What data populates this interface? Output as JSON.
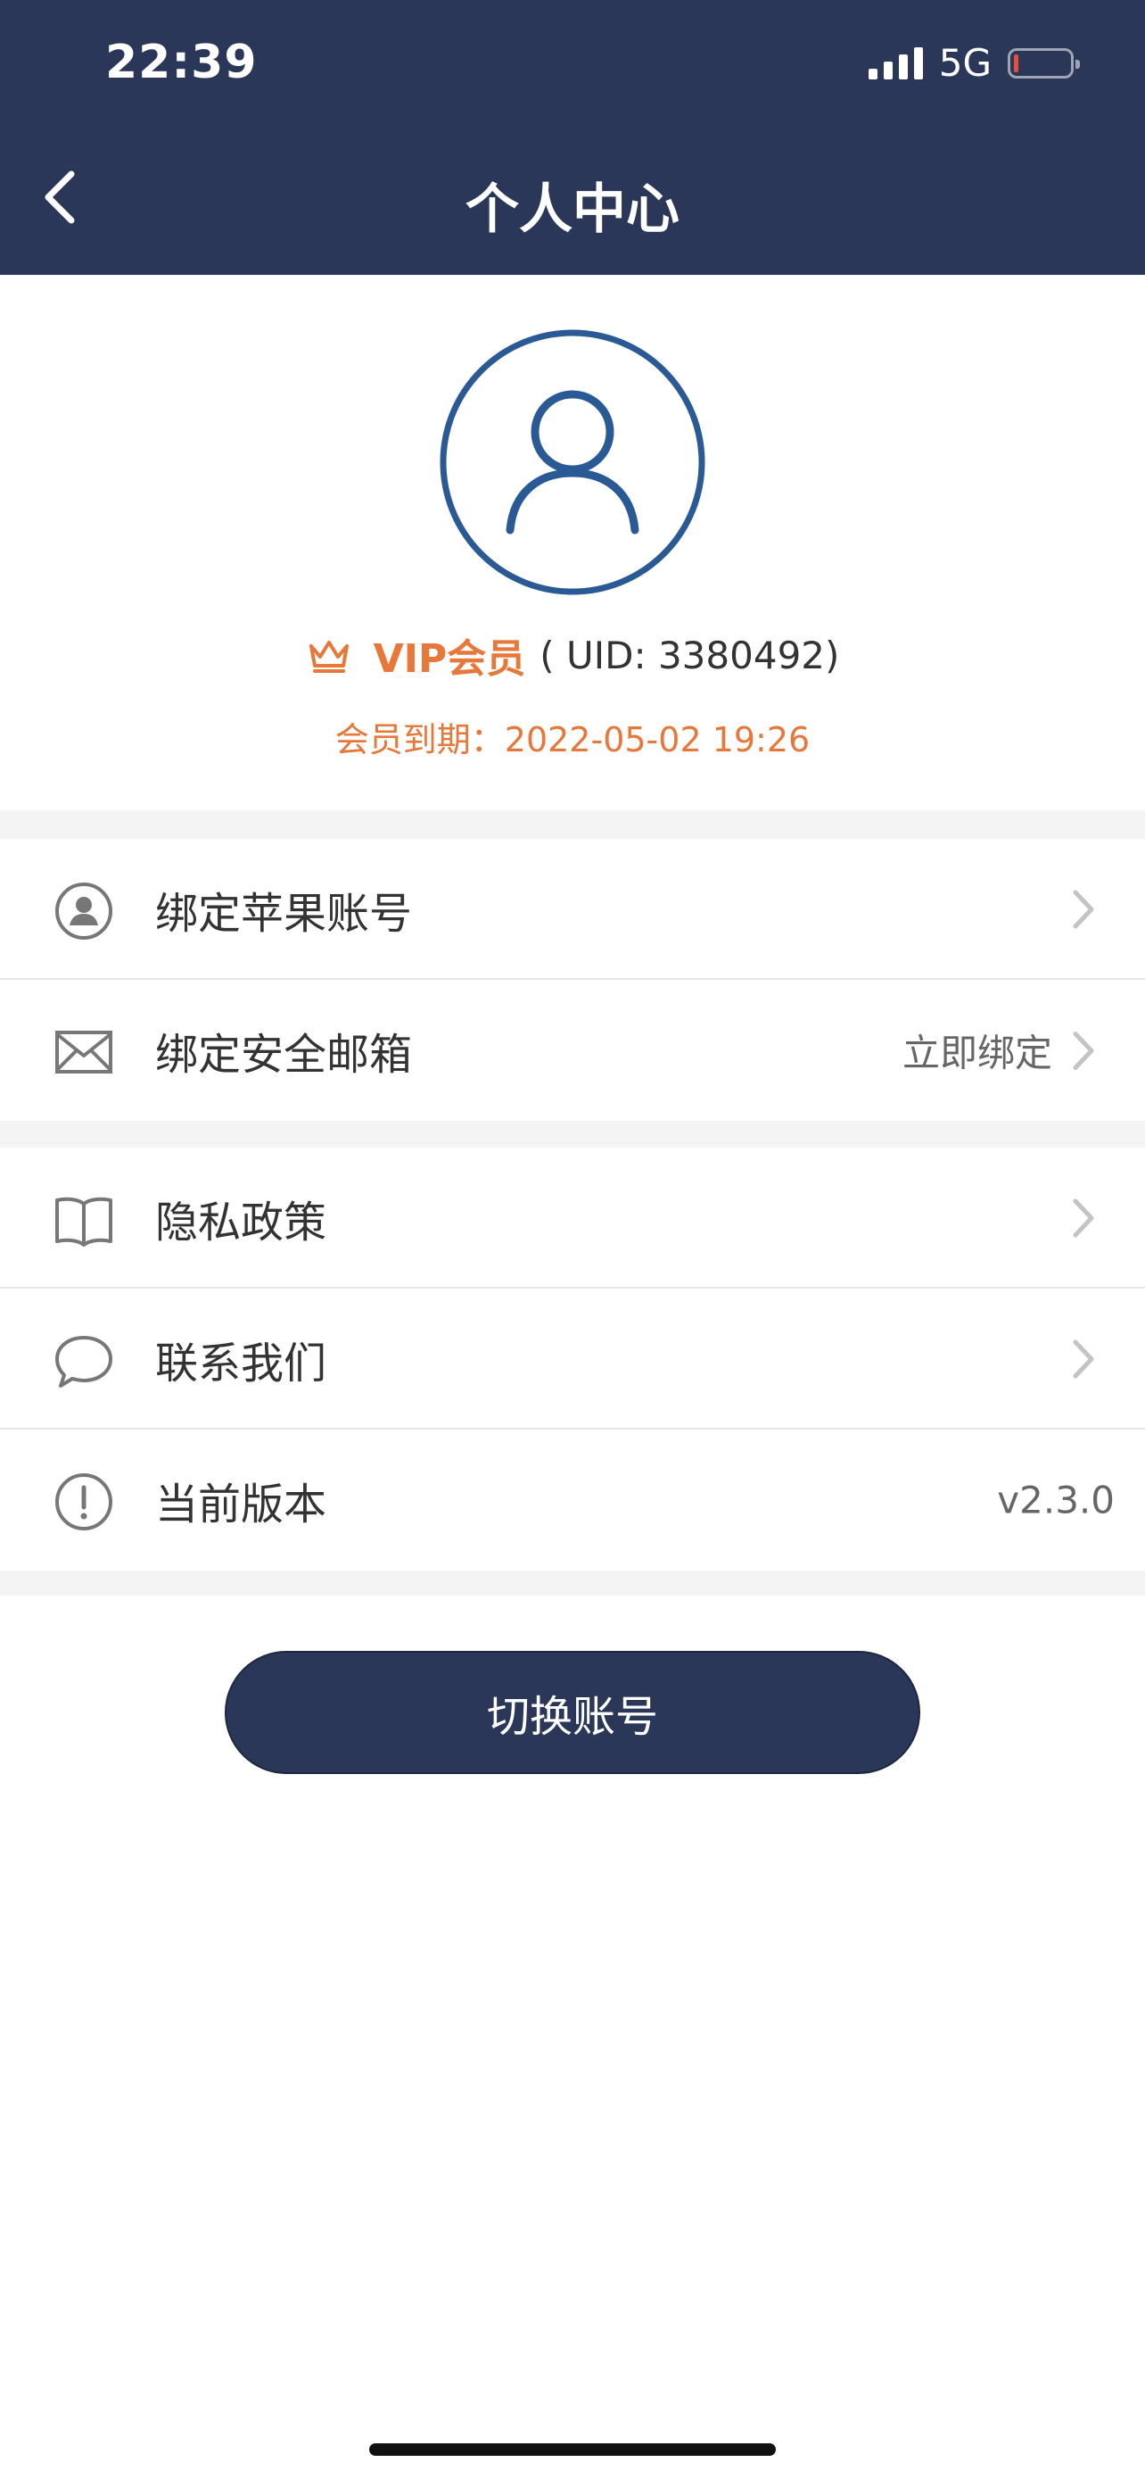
{
  "status_bar": {
    "time": "22:39",
    "network": "5G"
  },
  "header": {
    "title": "个人中心"
  },
  "profile": {
    "vip_label": "VIP会员",
    "uid_text": "( UID: 3380492)",
    "expire_text": "会员到期：2022-05-02 19:26"
  },
  "list": {
    "bind_apple": {
      "label": "绑定苹果账号"
    },
    "bind_email": {
      "label": "绑定安全邮箱",
      "value": "立即绑定"
    },
    "privacy": {
      "label": "隐私政策"
    },
    "contact": {
      "label": "联系我们"
    },
    "version": {
      "label": "当前版本",
      "value": "v2.3.0"
    }
  },
  "actions": {
    "switch_account": "切换账号"
  },
  "colors": {
    "header_bg": "#2b3758",
    "accent_orange": "#e8773a",
    "avatar_blue": "#2a5a96"
  }
}
